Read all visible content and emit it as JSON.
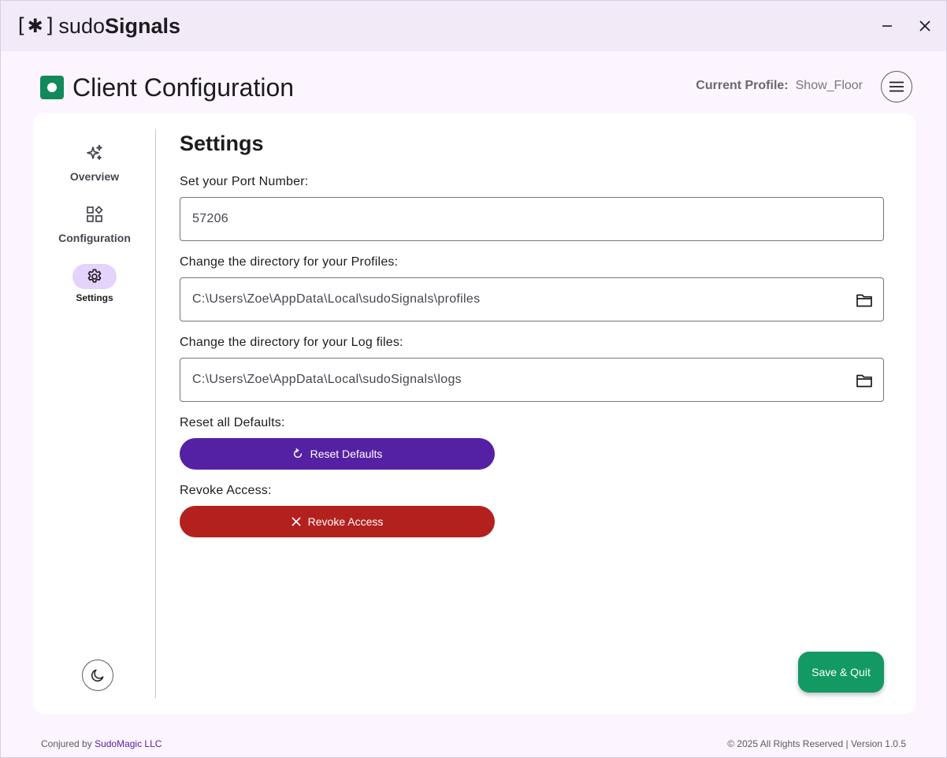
{
  "app": {
    "logo_open_bracket": "[",
    "logo_star": "✱",
    "logo_close_bracket": "]",
    "logo_sudo": "sudo",
    "logo_signals": "Signals"
  },
  "header": {
    "title": "Client Configuration",
    "profile_label": "Current Profile:",
    "profile_value": "Show_Floor"
  },
  "nav": {
    "items": [
      {
        "label": "Overview",
        "icon": "sparkle-icon"
      },
      {
        "label": "Configuration",
        "icon": "widgets-icon"
      },
      {
        "label": "Settings",
        "icon": "gear-icon"
      }
    ]
  },
  "settings": {
    "title": "Settings",
    "port_label": "Set your Port Number:",
    "port_value": "57206",
    "profiles_label": "Change the directory for your Profiles:",
    "profiles_value": "C:\\Users\\Zoe\\AppData\\Local\\sudoSignals\\profiles",
    "logs_label": "Change the directory for your Log files:",
    "logs_value": "C:\\Users\\Zoe\\AppData\\Local\\sudoSignals\\logs",
    "reset_label": "Reset all Defaults:",
    "reset_button": "Reset Defaults",
    "revoke_label": "Revoke Access:",
    "revoke_button": "Revoke Access",
    "save_button": "Save & Quit"
  },
  "footer": {
    "left_prefix": "Conjured by",
    "left_link": "SudoMagic LLC",
    "right": "© 2025 All Rights Reserved | Version 1.0.5"
  },
  "colors": {
    "accent": "#5521a4",
    "danger": "#b3211f",
    "success": "#139a63",
    "brand_icon": "#12895a"
  }
}
